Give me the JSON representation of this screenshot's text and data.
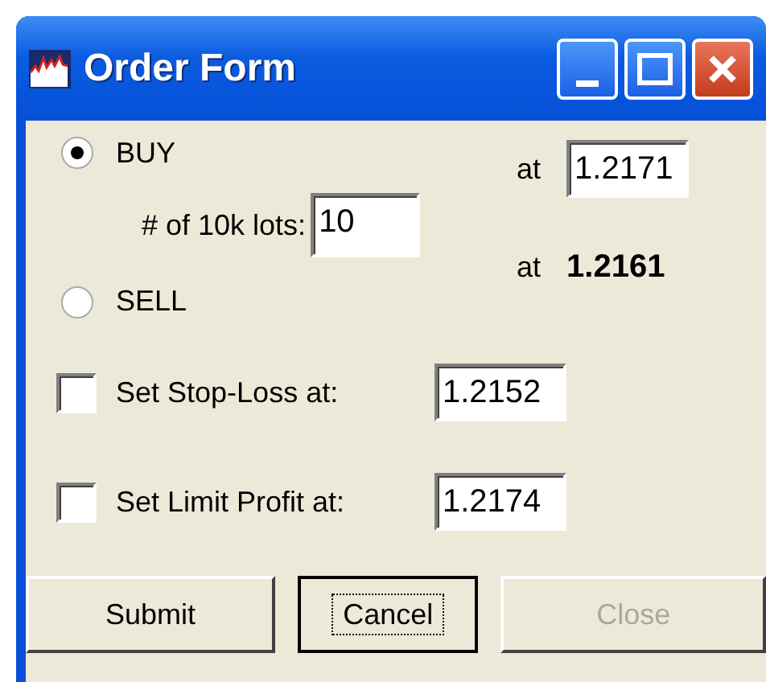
{
  "window": {
    "title": "Order Form"
  },
  "sides": [
    {
      "label": "BUY",
      "selected": true
    },
    {
      "label": "SELL",
      "selected": false
    }
  ],
  "lots": {
    "label": "# of 10k lots:",
    "value": "10"
  },
  "buy_price": {
    "label": "at",
    "value": "1.2171"
  },
  "sell_price": {
    "label": "at",
    "value": "1.2161"
  },
  "options": [
    {
      "label": "Set Stop-Loss at:",
      "checked": false,
      "value": "1.2152"
    },
    {
      "label": "Set Limit Profit at:",
      "checked": false,
      "value": "1.2174"
    }
  ],
  "buttons": [
    {
      "label": "Submit",
      "focused": false,
      "disabled": false
    },
    {
      "label": "Cancel",
      "focused": true,
      "disabled": false
    },
    {
      "label": "Close",
      "focused": false,
      "disabled": true
    }
  ]
}
